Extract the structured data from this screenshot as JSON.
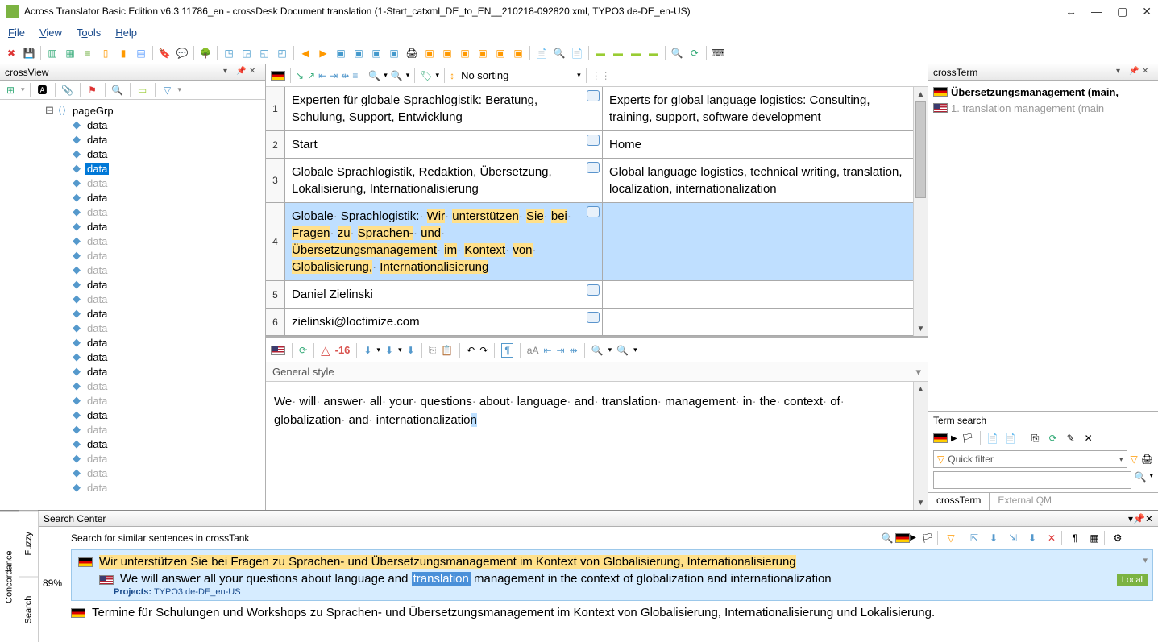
{
  "title": "Across Translator Basic Edition v6.3 11786_en - crossDesk Document translation (1-Start_catxml_DE_to_EN__210218-092820.xml, TYPO3 de-DE_en-US)",
  "menu": {
    "file": "File",
    "view": "View",
    "tools": "Tools",
    "help": "Help"
  },
  "panels": {
    "crossview": "crossView",
    "crossterm": "crossTerm",
    "search_center": "Search Center",
    "term_search": "Term search"
  },
  "tree": {
    "root": "pageGrp",
    "items": [
      {
        "label": "data",
        "dim": false
      },
      {
        "label": "data",
        "dim": false
      },
      {
        "label": "data",
        "dim": false
      },
      {
        "label": "data",
        "dim": false,
        "selected": true
      },
      {
        "label": "data",
        "dim": true
      },
      {
        "label": "data",
        "dim": false
      },
      {
        "label": "data",
        "dim": true
      },
      {
        "label": "data",
        "dim": false
      },
      {
        "label": "data",
        "dim": true
      },
      {
        "label": "data",
        "dim": true
      },
      {
        "label": "data",
        "dim": true
      },
      {
        "label": "data",
        "dim": false
      },
      {
        "label": "data",
        "dim": true
      },
      {
        "label": "data",
        "dim": false
      },
      {
        "label": "data",
        "dim": true
      },
      {
        "label": "data",
        "dim": false
      },
      {
        "label": "data",
        "dim": false
      },
      {
        "label": "data",
        "dim": false
      },
      {
        "label": "data",
        "dim": true
      },
      {
        "label": "data",
        "dim": true
      },
      {
        "label": "data",
        "dim": false
      },
      {
        "label": "data",
        "dim": true
      },
      {
        "label": "data",
        "dim": false
      },
      {
        "label": "data",
        "dim": true
      },
      {
        "label": "data",
        "dim": true
      },
      {
        "label": "data",
        "dim": true
      }
    ]
  },
  "sort_label": "No sorting",
  "segments": [
    {
      "n": "1",
      "src": "Experten für globale Sprachlogistik: Beratung, Schulung, Support, Entwicklung",
      "tgt": "Experts for global language logistics: Consulting, training, support, software development"
    },
    {
      "n": "2",
      "src": "Start",
      "tgt": "Home"
    },
    {
      "n": "3",
      "src": "Globale Sprachlogistik, Redaktion, Übersetzung, Lokalisierung, Internationalisierung",
      "tgt": "Global language logistics, technical writing, translation, localization, internationalization"
    },
    {
      "n": "4",
      "src_tokens": [
        "Globale",
        "Sprachlogistik:",
        "Wir",
        "unterstützen",
        "Sie",
        "bei",
        "Fragen",
        "zu",
        "Sprachen-",
        "und",
        "Übersetzungsmanagement",
        "im",
        "Kontext",
        "von",
        "Globalisierung,",
        "Internationalisierung"
      ],
      "tgt": "",
      "active": true
    },
    {
      "n": "5",
      "src": "Daniel Zielinski",
      "tgt": ""
    },
    {
      "n": "6",
      "src": "zielinski@loctimize.com",
      "tgt": ""
    }
  ],
  "editor": {
    "delta": "-16",
    "style": "General style",
    "text_tokens": [
      "We",
      "will",
      "answer",
      "all",
      "your",
      "questions",
      "about",
      "language",
      "and",
      "translation",
      "management",
      "in",
      "the",
      "context",
      "of",
      "globalization",
      "and",
      "internationalizatio"
    ],
    "cursor_char": "n"
  },
  "crossterm": {
    "items": [
      {
        "flag": "de",
        "text": "Übersetzungsmanagement (main,",
        "bold": true
      },
      {
        "flag": "us",
        "text": "1.  translation management (main",
        "bold": false
      }
    ],
    "quick_filter": "Quick filter",
    "tabs": {
      "active": "crossTerm",
      "inactive": "External QM"
    }
  },
  "search_center": {
    "searchbar_label": "Search for similar sentences in crossTank",
    "side_tabs": [
      "Concordance",
      "Fuzzy",
      "Search"
    ],
    "match": {
      "pct": "89%",
      "src": "Wir unterstützen Sie bei Fragen zu Sprachen- und Übersetzungsmanagement im Kontext von Globalisierung, Internationalisierung",
      "tgt_pre": "We will answer all your questions about language and ",
      "tgt_hl": "translation",
      "tgt_post": " management in the context of globalization and internationalization",
      "projects_label": "Projects:",
      "projects_val": "TYPO3 de-DE_en-US",
      "local": "Local"
    },
    "other": "Termine für Schulungen und Workshops zu Sprachen- und Übersetzungsmanagement im Kontext von Globalisierung, Internationalisierung und Lokalisierung."
  }
}
